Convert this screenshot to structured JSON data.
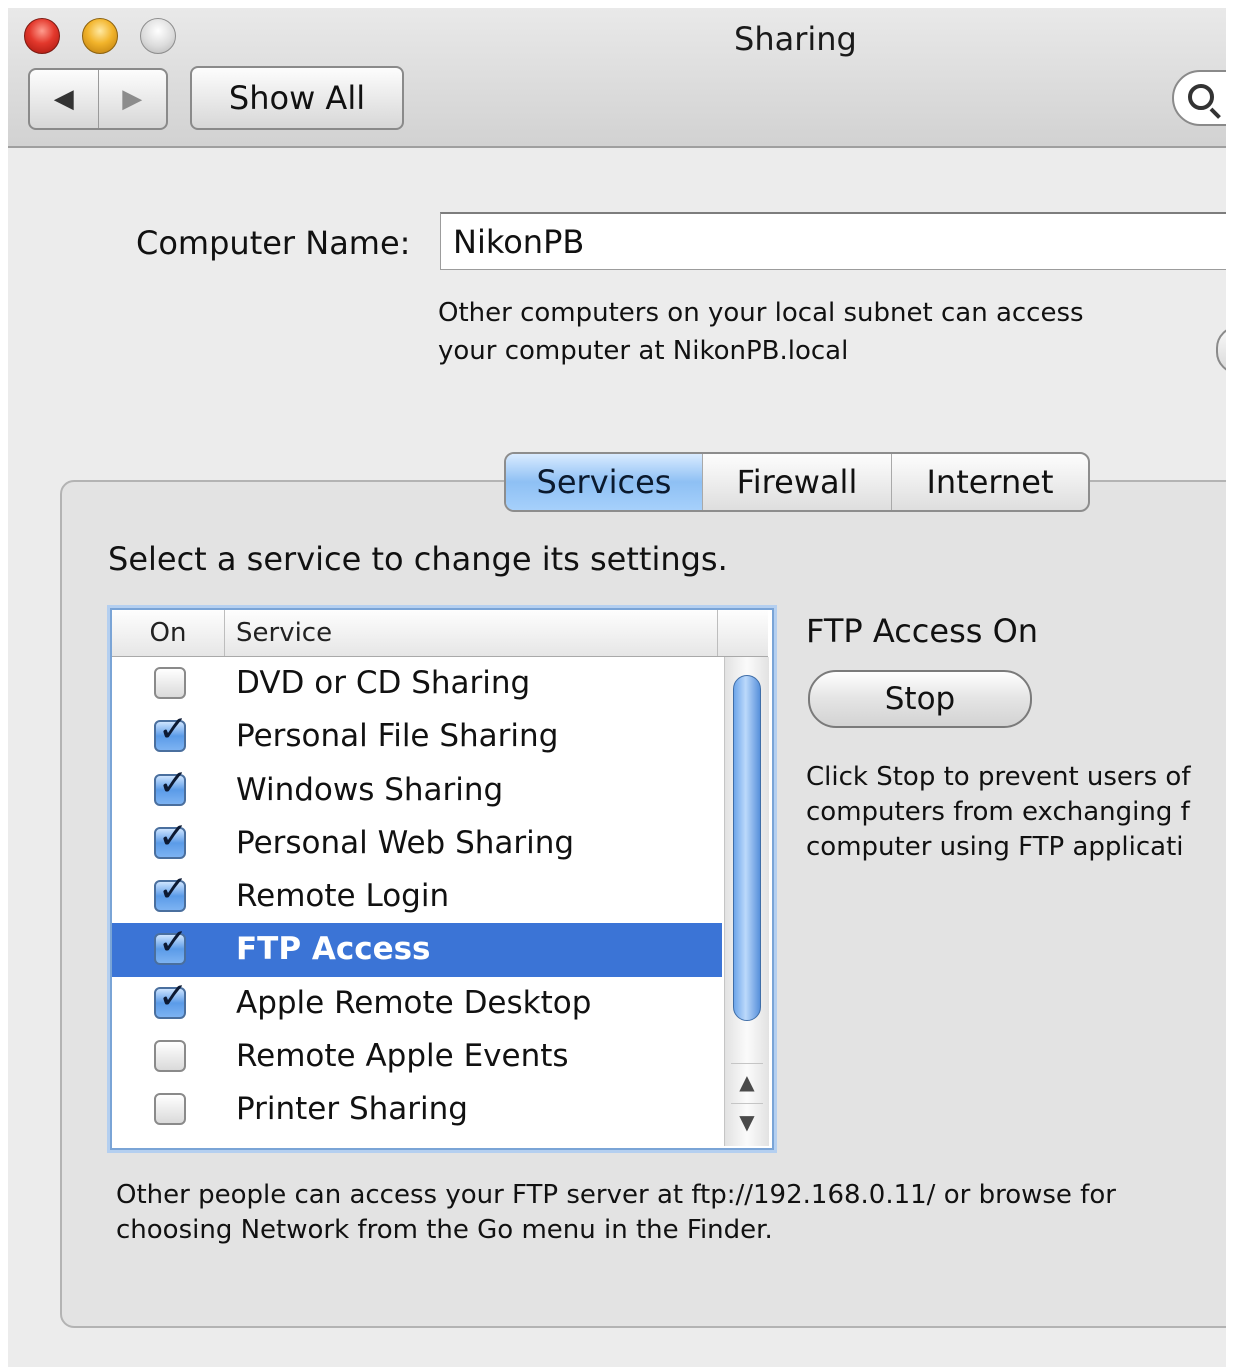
{
  "window": {
    "title": "Sharing",
    "buttons": {
      "close": "close-button",
      "minimize": "minimize-button",
      "zoom": "zoom-button"
    }
  },
  "toolbar": {
    "back_icon": "◀",
    "forward_icon": "▶",
    "show_all_label": "Show All",
    "search_icon": "search-icon"
  },
  "computer_name": {
    "label": "Computer Name:",
    "value": "NikonPB",
    "description_line1": "Other computers on your local subnet can access",
    "description_line2": "your computer at NikonPB.local"
  },
  "tabs": [
    {
      "label": "Services",
      "active": true
    },
    {
      "label": "Firewall",
      "active": false
    },
    {
      "label": "Internet",
      "active": false
    }
  ],
  "services": {
    "instruction": "Select a service to change its settings.",
    "columns": {
      "on": "On",
      "service": "Service"
    },
    "items": [
      {
        "name": "DVD or CD Sharing",
        "on": false,
        "selected": false
      },
      {
        "name": "Personal File Sharing",
        "on": true,
        "selected": false
      },
      {
        "name": "Windows Sharing",
        "on": true,
        "selected": false
      },
      {
        "name": "Personal Web Sharing",
        "on": true,
        "selected": false
      },
      {
        "name": "Remote Login",
        "on": true,
        "selected": false
      },
      {
        "name": "FTP Access",
        "on": true,
        "selected": true
      },
      {
        "name": "Apple Remote Desktop",
        "on": true,
        "selected": false
      },
      {
        "name": "Remote Apple Events",
        "on": false,
        "selected": false
      },
      {
        "name": "Printer Sharing",
        "on": false,
        "selected": false
      }
    ],
    "scroll_up_icon": "▲",
    "scroll_down_icon": "▼"
  },
  "detail": {
    "status": "FTP Access On",
    "stop_label": "Stop",
    "help_text": "Click Stop to prevent users of\ncomputers from exchanging f\ncomputer using FTP applicati",
    "footer_text": "Other people can access your FTP server at ftp://192.168.0.11/ or browse for\nchoosing Network from the Go menu in the Finder."
  },
  "colors": {
    "selection": "#3b74d6",
    "aqua_blue": "#8ec0f4"
  }
}
